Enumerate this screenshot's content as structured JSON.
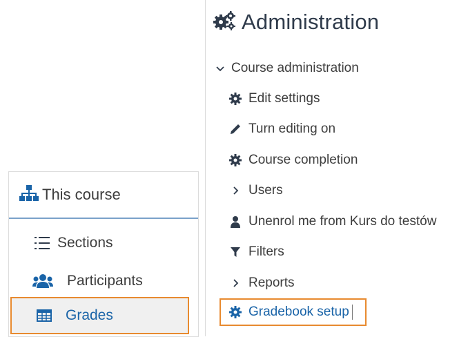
{
  "left_panel": {
    "header": {
      "title": "This course",
      "icon": "sitemap-icon"
    },
    "items": [
      {
        "label": "Sections",
        "icon": "list-icon"
      },
      {
        "label": "Participants",
        "icon": "users-icon"
      },
      {
        "label": "Grades",
        "icon": "table-icon",
        "highlighted": true
      }
    ]
  },
  "admin": {
    "title": "Administration",
    "title_icon": "cogs-icon",
    "section": {
      "label": "Course administration",
      "icon": "chevron-down-icon",
      "expanded": true
    },
    "items": [
      {
        "label": "Edit settings",
        "icon": "gear-icon"
      },
      {
        "label": "Turn editing on",
        "icon": "pencil-icon"
      },
      {
        "label": "Course completion",
        "icon": "gear-icon"
      },
      {
        "label": "Users",
        "icon": "chevron-right-icon"
      },
      {
        "label": "Unenrol me from Kurs do testów",
        "icon": "user-icon"
      },
      {
        "label": "Filters",
        "icon": "filter-icon"
      },
      {
        "label": "Reports",
        "icon": "chevron-right-icon"
      },
      {
        "label": "Gradebook setup",
        "icon": "gear-icon",
        "highlighted": true
      }
    ]
  },
  "colors": {
    "highlight_border": "#e88a2f",
    "link_blue": "#1a64a8",
    "header_rule": "#7aa1c9"
  }
}
